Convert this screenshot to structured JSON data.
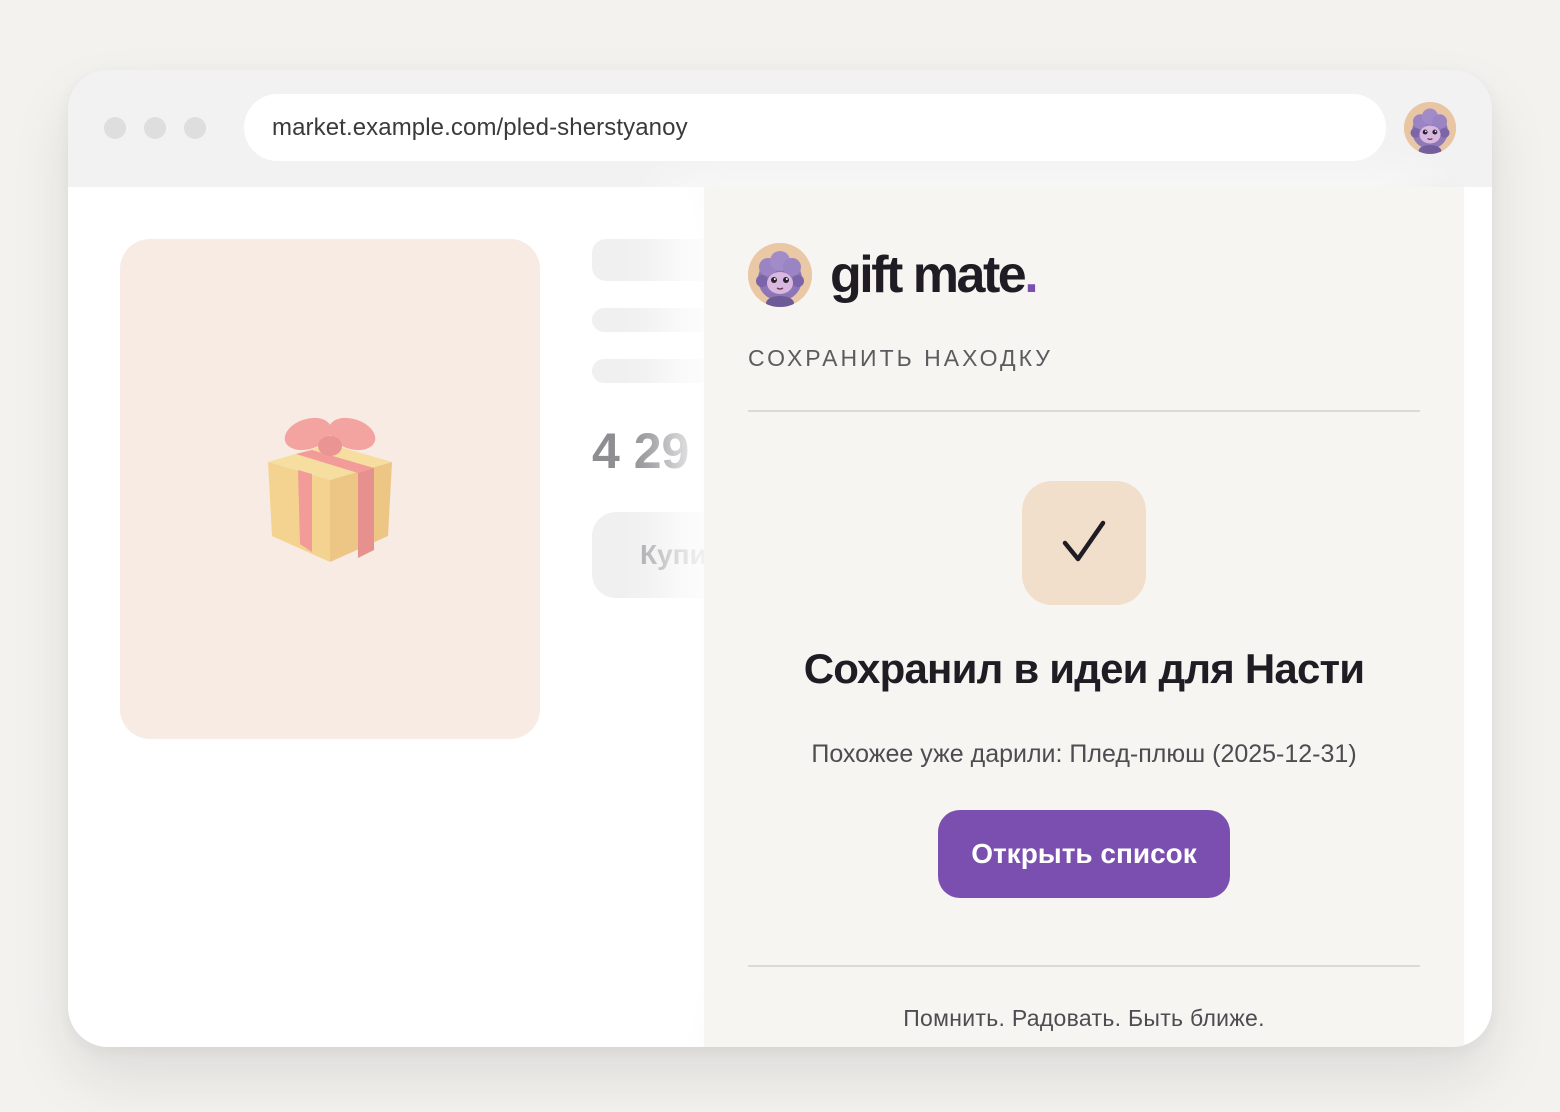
{
  "browser": {
    "url": "market.example.com/pled-sherstyanoy",
    "extension_icon": "sheep-mascot-icon"
  },
  "product_page": {
    "image_icon": "gift-box-icon",
    "price_visible": "4 29",
    "buy_button_visible": "Купи"
  },
  "panel": {
    "brand_name": "gift mate",
    "brand_dot": ".",
    "section_title": "СОХРАНИТЬ НАХОДКУ",
    "status_icon": "checkmark-icon",
    "headline": "Сохранил в идеи для Насти",
    "similar_note": "Похожее уже дарили: Плед-плюш (2025-12-31)",
    "open_list_button": "Открыть список",
    "tagline": "Помнить. Радовать. Быть ближе."
  },
  "colors": {
    "accent": "#7a4fb0",
    "panel_bg": "#f7f5f2",
    "check_bg": "#f1dfcc",
    "text_dark": "#1f1c24"
  }
}
